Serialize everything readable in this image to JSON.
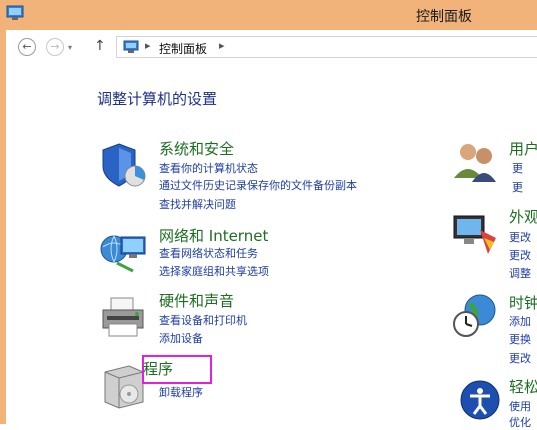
{
  "window": {
    "title": "控制面板"
  },
  "nav": {
    "address_path": "控制面板"
  },
  "main": {
    "heading": "调整计算机的设置",
    "categories": [
      {
        "title": "系统和安全",
        "links": [
          "查看你的计算机状态",
          "通过文件历史记录保存你的文件备份副本",
          "查找并解决问题"
        ]
      },
      {
        "title": "网络和 Internet",
        "links": [
          "查看网络状态和任务",
          "选择家庭组和共享选项"
        ]
      },
      {
        "title": "硬件和声音",
        "links": [
          "查看设备和打印机",
          "添加设备"
        ]
      },
      {
        "title": "程序",
        "links": [
          "卸载程序"
        ]
      }
    ],
    "right_categories": [
      {
        "title": "用户",
        "links": [
          "更",
          "更"
        ]
      },
      {
        "title": "外观",
        "links": [
          "更改",
          "更改",
          "调整"
        ]
      },
      {
        "title": "时钟",
        "links": [
          "添加",
          "更换",
          "更改"
        ]
      },
      {
        "title": "轻松",
        "links": [
          "使用",
          "优化"
        ]
      }
    ]
  },
  "colors": {
    "title_bar": "#f2b37a",
    "category_title": "#1e6e22",
    "link": "#1e3da6",
    "heading": "#1e3287",
    "highlight_box": "#e020e0"
  },
  "icons": [
    "control-panel-icon",
    "back-arrow-icon",
    "forward-arrow-icon",
    "up-arrow-icon",
    "shield-chart-icon",
    "network-globe-icon",
    "printer-icon",
    "program-box-icon",
    "users-icon",
    "monitor-palette-icon",
    "clock-globe-icon",
    "ease-access-icon"
  ]
}
